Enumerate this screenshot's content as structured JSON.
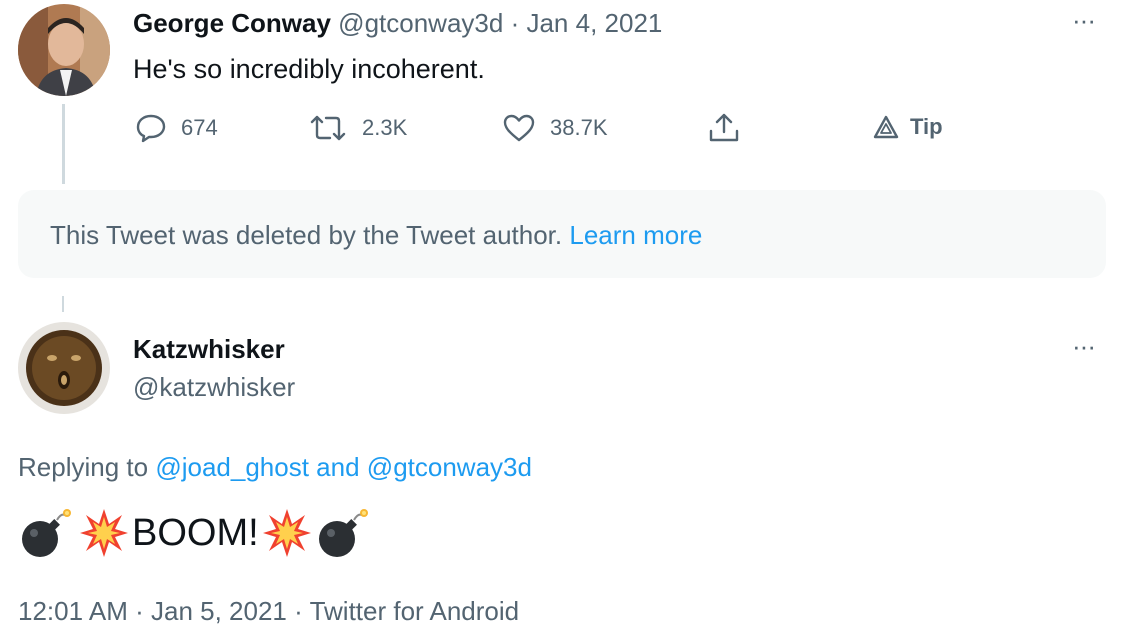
{
  "tweet1": {
    "author_name": "George Conway",
    "author_handle": "@gtconway3d",
    "separator": "·",
    "date": "Jan 4, 2021",
    "text": "He's so incredibly incoherent.",
    "more_icon": "ellipsis-icon",
    "actions": {
      "replies": "674",
      "retweets": "2.3K",
      "likes": "38.7K",
      "tip_label": "Tip"
    }
  },
  "deleted_notice": {
    "text": "This Tweet was deleted by the Tweet author.",
    "link": "Learn more"
  },
  "tweet2": {
    "author_name": "Katzwhisker",
    "author_handle": "@katzwhisker",
    "more_icon": "ellipsis-icon",
    "replying_prefix": "Replying to",
    "replying_user1": "@joad_ghost",
    "replying_and": "and",
    "replying_user2": "@gtconway3d",
    "text_word": "BOOM!",
    "emoji": [
      "bomb-icon",
      "collision-icon",
      "collision-icon",
      "bomb-icon"
    ],
    "time": "12:01 AM",
    "date": "Jan 5, 2021",
    "source": "Twitter for Android",
    "separator": "·"
  },
  "colors": {
    "link": "#1d9bf0",
    "muted": "#536471",
    "notice_bg": "#f7f9f9"
  }
}
